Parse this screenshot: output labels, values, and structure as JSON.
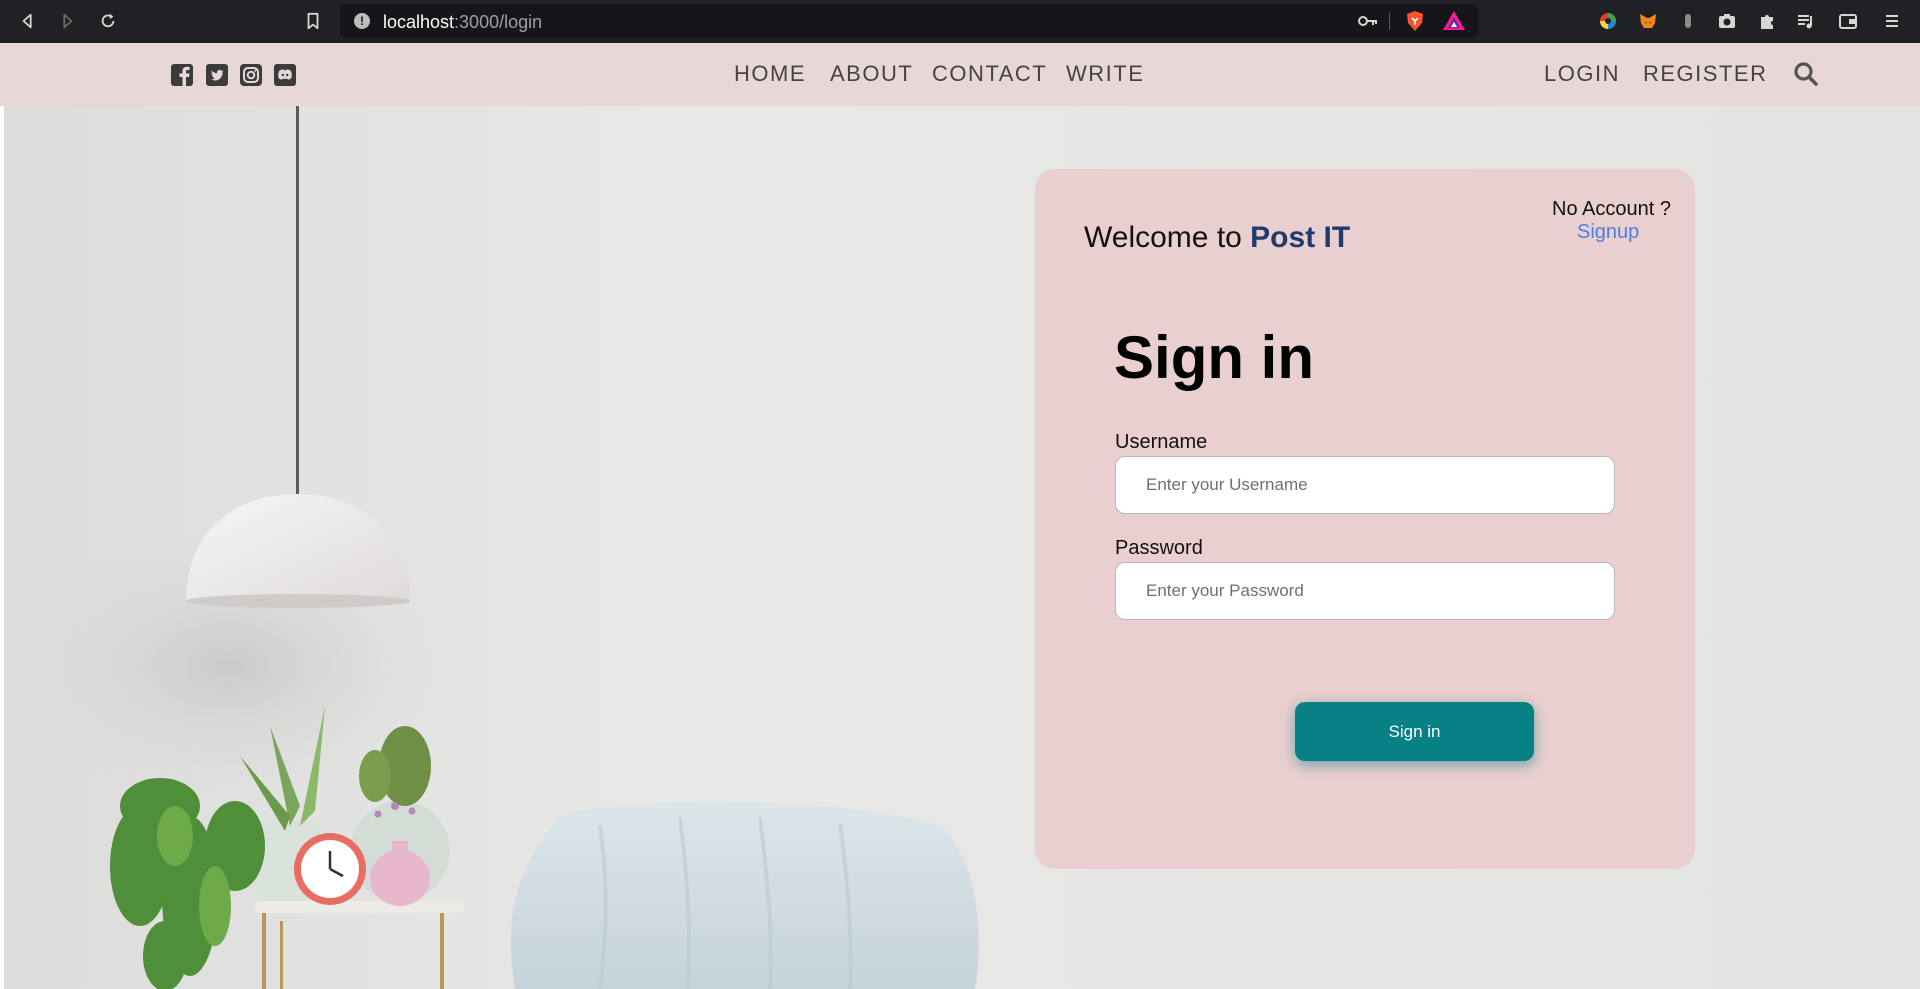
{
  "browser": {
    "url_host": "localhost",
    "url_rest": ":3000/login"
  },
  "nav": {
    "items": [
      "HOME",
      "ABOUT",
      "CONTACT",
      "WRITE"
    ],
    "auth": [
      "LOGIN",
      "REGISTER"
    ]
  },
  "social": [
    "facebook-icon",
    "twitter-icon",
    "instagram-icon",
    "discord-icon"
  ],
  "login": {
    "no_account": "No Account ?",
    "signup_link": "Signup",
    "welcome_prefix": "Welcome to ",
    "brand": "Post IT",
    "title": "Sign in",
    "username_label": "Username",
    "username_placeholder": "Enter your Username",
    "password_label": "Password",
    "password_placeholder": "Enter your Password",
    "submit_label": "Sign in"
  },
  "colors": {
    "header_bg": "#e9d6d6",
    "card_bg": "#eacfd0",
    "button": "#078183",
    "brand": "#1f3a6e",
    "link": "#4a7fe0"
  }
}
